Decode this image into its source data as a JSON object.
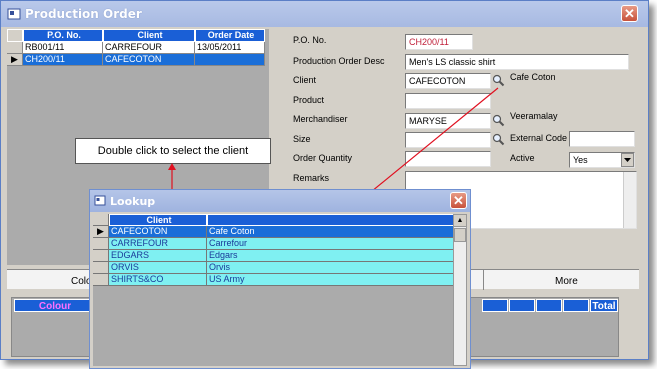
{
  "window": {
    "title": "Production Order",
    "close_glyph": "✕"
  },
  "orders_grid": {
    "columns": [
      "P.O. No.",
      "Client",
      "Order Date"
    ],
    "rows": [
      {
        "po": "RB001/11",
        "client": "CARREFOUR",
        "date": "13/05/2011"
      },
      {
        "po": "CH200/11",
        "client": "CAFECOTON",
        "date": ""
      }
    ],
    "selected_marker": "▶"
  },
  "form": {
    "po_no": {
      "label": "P.O. No.",
      "value": "CH200/11"
    },
    "desc": {
      "label": "Production Order Desc",
      "value": "Men's LS classic shirt"
    },
    "client": {
      "label": "Client",
      "value": "CAFECOTON",
      "resolved": "Cafe Coton"
    },
    "product": {
      "label": "Product",
      "value": ""
    },
    "merchandiser": {
      "label": "Merchandiser",
      "value": "MARYSE",
      "resolved": "Veeramalay"
    },
    "size": {
      "label": "Size",
      "value": ""
    },
    "external_code": {
      "label": "External Code",
      "value": ""
    },
    "order_quantity": {
      "label": "Order Quantity",
      "value": ""
    },
    "active": {
      "label": "Active",
      "value": "Yes"
    },
    "remarks": {
      "label": "Remarks",
      "value": ""
    }
  },
  "bottom": {
    "tab_left": "Colo",
    "tab_right": "More",
    "col_colour": "Colour",
    "col_total": "Total"
  },
  "callout": {
    "text": "Double click to select the client"
  },
  "lookup": {
    "title": "Lookup",
    "close_glyph": "✕",
    "column": "Client",
    "selected_marker": "▶",
    "rows": [
      {
        "code": "CAFECOTON",
        "name": "Cafe Coton"
      },
      {
        "code": "CARREFOUR",
        "name": "Carrefour"
      },
      {
        "code": "EDGARS",
        "name": "Edgars"
      },
      {
        "code": "ORVIS",
        "name": "Orvis"
      },
      {
        "code": "SHIRTS&CO",
        "name": "US Army"
      }
    ],
    "scroll_up": "▲"
  },
  "colors": {
    "header_blue": "#1a5fd6",
    "selected_row": "#1a6ed8",
    "lookup_row": "#7ff0f2",
    "accent_red": "#c0203a"
  }
}
